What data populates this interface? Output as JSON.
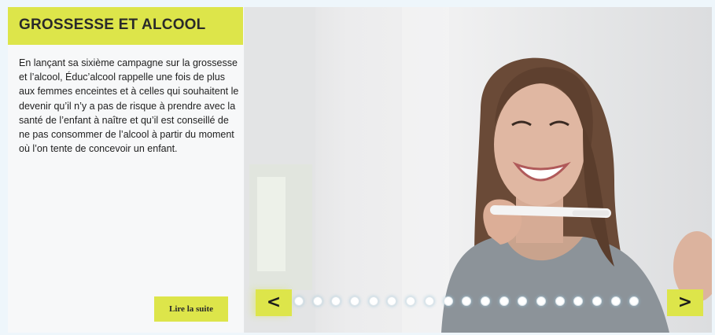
{
  "panel": {
    "title": "GROSSESSE ET ALCOOL",
    "body": "En lançant sa sixième campagne sur la grossesse et l’alcool, Éduc’alcool rappelle une fois de plus aux femmes enceintes et à celles qui souhaitent le devenir qu’il n’y a pas de risque à prendre avec la santé de l’enfant à naître et qu’il est conseillé de ne pas consommer de l’alcool à partir du moment où l’on tente de concevoir un enfant.",
    "read_more_label": "Lire la suite"
  },
  "carousel": {
    "prev_label": "<",
    "next_label": ">",
    "dot_count": 19
  },
  "colors": {
    "accent": "#dde54a",
    "text": "#1e1e1e",
    "page_background": "#eef6fb"
  }
}
